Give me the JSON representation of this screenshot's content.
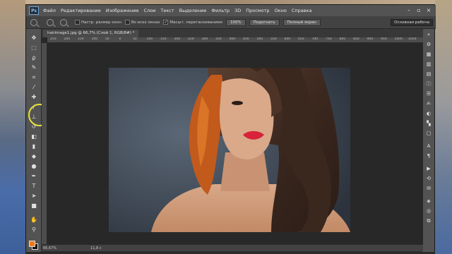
{
  "menu": {
    "logo": "Ps",
    "items": [
      "Файл",
      "Редактирование",
      "Изображение",
      "Слои",
      "Текст",
      "Выделение",
      "Фильтр",
      "3D",
      "Просмотр",
      "Окно",
      "Справка"
    ]
  },
  "options": {
    "check1": "Настр. размер окон",
    "check2": "Во всех окнах",
    "check3": "Масшт. перетаскиванием",
    "zoom_btn": "100%",
    "fit_btn": "Подогнать",
    "full_btn": "Полный экран",
    "workspace": "Основная рабоча"
  },
  "document": {
    "tab_label": "hairimage1.jpg @ 66,7% (Слой 1, RGB/8#) *"
  },
  "ruler": {
    "ticks": [
      "250",
      "200",
      "150",
      "100",
      "50",
      "0",
      "50",
      "100",
      "150",
      "200",
      "250",
      "300",
      "350",
      "400",
      "450",
      "500",
      "550",
      "600",
      "650",
      "700",
      "750",
      "800",
      "850",
      "900",
      "950",
      "1000",
      "1050"
    ]
  },
  "status": {
    "zoom": "66,67%",
    "doc_size": "11,8 с"
  },
  "colors": {
    "foreground": "#f07a1e",
    "background": "#111111",
    "highlight": "#e8e23a"
  }
}
